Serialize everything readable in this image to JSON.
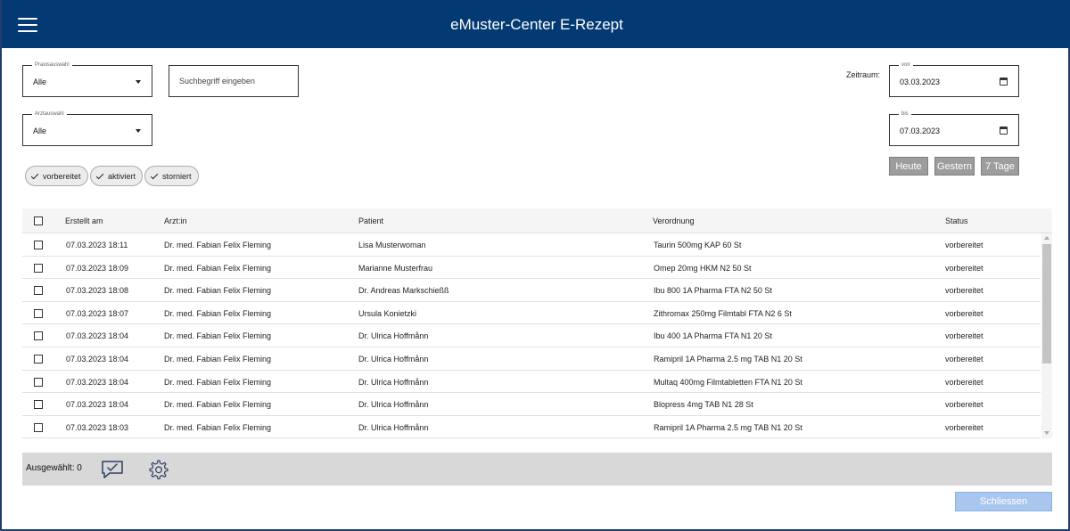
{
  "app": {
    "title": "eMuster-Center E-Rezept"
  },
  "filters": {
    "praxis": {
      "legend": "Praxisauswahl",
      "value": "Alle"
    },
    "arzt": {
      "legend": "Arztauswahl",
      "value": "Alle"
    },
    "search": {
      "placeholder": "Suchbegriff eingeben"
    },
    "zeitraum_label": "Zeitraum:",
    "von": {
      "legend": "von",
      "value": "03.03.2023"
    },
    "bis": {
      "legend": "bis",
      "value": "07.03.2023"
    },
    "status_chips": [
      "vorbereitet",
      "aktiviert",
      "storniert"
    ],
    "quick_buttons": [
      "Heute",
      "Gestern",
      "7 Tage"
    ]
  },
  "table": {
    "headers": {
      "erstellt": "Erstellt am",
      "arzt": "Arzt:in",
      "patient": "Patient",
      "verordnung": "Verordnung",
      "status": "Status"
    },
    "rows": [
      {
        "erstellt": "07.03.2023 18:11",
        "arzt": "Dr. med. Fabian Felix Fleming",
        "patient": "Lisa Musterwoman",
        "verordnung": "Taurin 500mg KAP 60 St",
        "status": "vorbereitet"
      },
      {
        "erstellt": "07.03.2023 18:09",
        "arzt": "Dr. med. Fabian Felix Fleming",
        "patient": "Marianne Musterfrau",
        "verordnung": "Omep 20mg HKM N2 50 St",
        "status": "vorbereitet"
      },
      {
        "erstellt": "07.03.2023 18:08",
        "arzt": "Dr. med. Fabian Felix Fleming",
        "patient": "Dr. Andreas Markschießß",
        "verordnung": "Ibu 800 1A Pharma FTA N2 50 St",
        "status": "vorbereitet"
      },
      {
        "erstellt": "07.03.2023 18:07",
        "arzt": "Dr. med. Fabian Felix Fleming",
        "patient": "Ursula Konietzki",
        "verordnung": "Zithromax 250mg Filmtabl FTA N2 6 St",
        "status": "vorbereitet"
      },
      {
        "erstellt": "07.03.2023 18:04",
        "arzt": "Dr. med. Fabian Felix Fleming",
        "patient": "Dr. Ulrica Hoffmånn",
        "verordnung": "Ibu 400 1A Pharma FTA N1 20 St",
        "status": "vorbereitet"
      },
      {
        "erstellt": "07.03.2023 18:04",
        "arzt": "Dr. med. Fabian Felix Fleming",
        "patient": "Dr. Ulrica Hoffmånn",
        "verordnung": "Ramipril 1A Pharma 2.5 mg TAB N1 20 St",
        "status": "vorbereitet"
      },
      {
        "erstellt": "07.03.2023 18:04",
        "arzt": "Dr. med. Fabian Felix Fleming",
        "patient": "Dr. Ulrica Hoffmånn",
        "verordnung": "Multaq 400mg Filmtabletten FTA N1 20 St",
        "status": "vorbereitet"
      },
      {
        "erstellt": "07.03.2023 18:04",
        "arzt": "Dr. med. Fabian Felix Fleming",
        "patient": "Dr. Ulrica Hoffmånn",
        "verordnung": "Blopress 4mg TAB N1 28 St",
        "status": "vorbereitet"
      },
      {
        "erstellt": "07.03.2023 18:03",
        "arzt": "Dr. med. Fabian Felix Fleming",
        "patient": "Dr. Ulrica Hoffmånn",
        "verordnung": "Ramipril 1A Pharma 2.5 mg TAB N1 20 St",
        "status": "vorbereitet"
      }
    ]
  },
  "footer": {
    "selected_label": "Ausgewählt: 0",
    "close_label": "Schliessen"
  }
}
